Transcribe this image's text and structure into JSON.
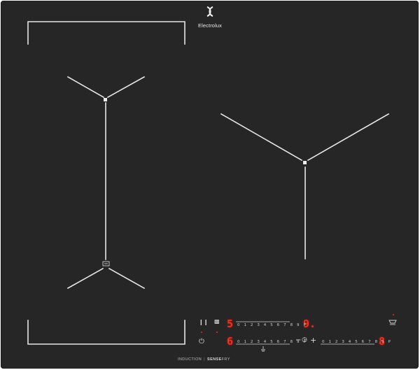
{
  "brand": {
    "name": "Electrolux"
  },
  "footer": {
    "left": "INDUCTION",
    "sense": "SENSE",
    "fry": "FRY"
  },
  "controls": {
    "zone_left_top_level": "5",
    "zone_left_bottom_level": "6",
    "zone_middle_level": "9.",
    "zone_right_level": "8",
    "scale": "0 1 2 3 4 5 6 7 8 9 P",
    "timer_minus": "−",
    "timer_plus": "+"
  },
  "colors": {
    "glass": "#262626",
    "markings": "#e6e6e6",
    "display": "#ff2a1c"
  },
  "icons": [
    "electrolux-logo-icon",
    "pause-icon",
    "lock-icon",
    "power-icon",
    "timer-icon",
    "hob2hood-icon",
    "bridge-icon",
    "sensefry-icon"
  ]
}
